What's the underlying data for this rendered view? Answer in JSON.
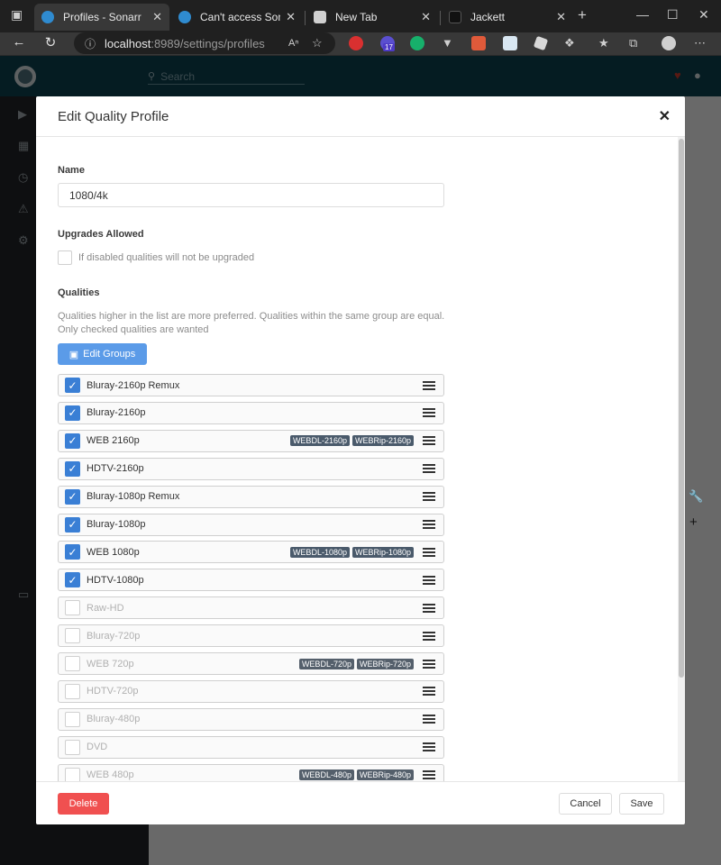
{
  "browser": {
    "tabs": [
      {
        "title": "Profiles - Sonarr",
        "favicon_color": "#2f8bd0"
      },
      {
        "title": "Can't access Sonarr on …",
        "favicon_color": "#2f8bd0"
      },
      {
        "title": "New Tab",
        "favicon_color": "#d0d0d0"
      },
      {
        "title": "Jackett",
        "favicon_color": "#111111"
      }
    ],
    "new_tab_label": "+",
    "url_host": "localhost",
    "url_path": ":8989/settings/profiles",
    "badge_count": "17"
  },
  "app": {
    "search_placeholder": "Search",
    "header_color": "#0d3e4d"
  },
  "modal": {
    "title": "Edit Quality Profile",
    "name_label": "Name",
    "name_value": "1080/4k",
    "upgrades_label": "Upgrades Allowed",
    "upgrades_help": "If disabled qualities will not be upgraded",
    "qualities_label": "Qualities",
    "qualities_help": "Qualities higher in the list are more preferred. Qualities within the same group are equal. Only checked qualities are wanted",
    "edit_groups_label": "Edit Groups",
    "qualities": [
      {
        "name": "Bluray-2160p Remux",
        "checked": true,
        "tags": []
      },
      {
        "name": "Bluray-2160p",
        "checked": true,
        "tags": []
      },
      {
        "name": "WEB 2160p",
        "checked": true,
        "tags": [
          "WEBDL-2160p",
          "WEBRip-2160p"
        ]
      },
      {
        "name": "HDTV-2160p",
        "checked": true,
        "tags": []
      },
      {
        "name": "Bluray-1080p Remux",
        "checked": true,
        "tags": []
      },
      {
        "name": "Bluray-1080p",
        "checked": true,
        "tags": []
      },
      {
        "name": "WEB 1080p",
        "checked": true,
        "tags": [
          "WEBDL-1080p",
          "WEBRip-1080p"
        ]
      },
      {
        "name": "HDTV-1080p",
        "checked": true,
        "tags": []
      },
      {
        "name": "Raw-HD",
        "checked": false,
        "tags": []
      },
      {
        "name": "Bluray-720p",
        "checked": false,
        "tags": []
      },
      {
        "name": "WEB 720p",
        "checked": false,
        "tags": [
          "WEBDL-720p",
          "WEBRip-720p"
        ]
      },
      {
        "name": "HDTV-720p",
        "checked": false,
        "tags": []
      },
      {
        "name": "Bluray-480p",
        "checked": false,
        "tags": []
      },
      {
        "name": "DVD",
        "checked": false,
        "tags": []
      },
      {
        "name": "WEB 480p",
        "checked": false,
        "tags": [
          "WEBDL-480p",
          "WEBRip-480p"
        ]
      }
    ],
    "delete_label": "Delete",
    "cancel_label": "Cancel",
    "save_label": "Save",
    "accent_color": "#3a7fd5",
    "danger_color": "#f05050"
  }
}
